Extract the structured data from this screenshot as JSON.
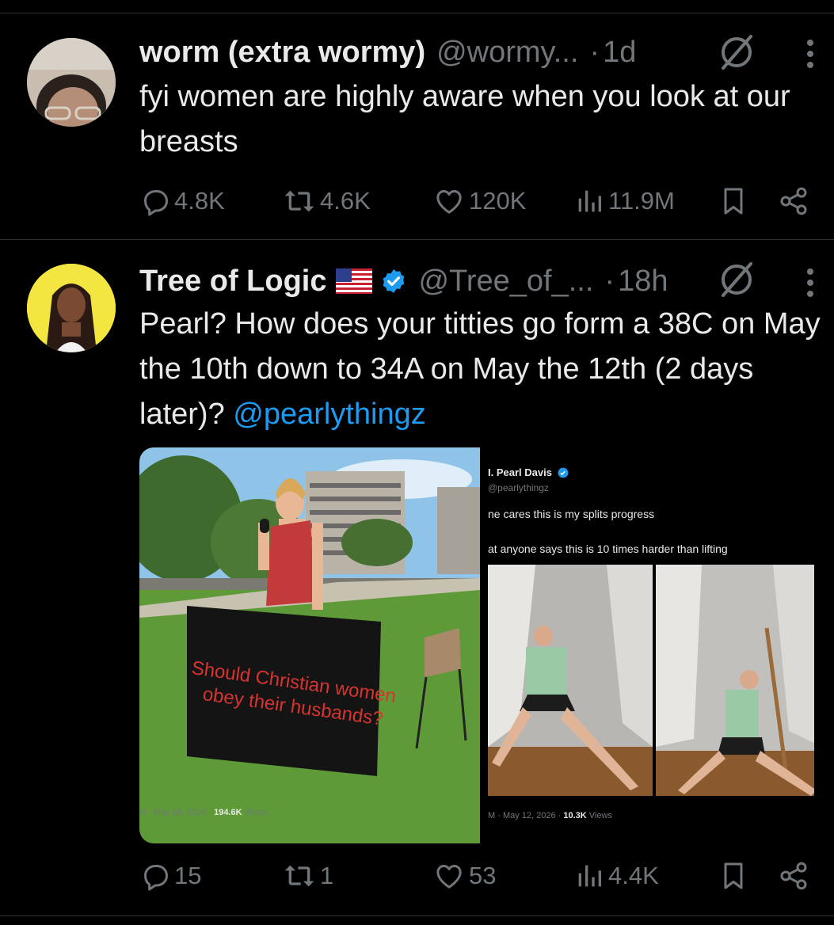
{
  "tweet1": {
    "name": "worm (extra wormy)",
    "handle": "@wormy...",
    "time": "1d",
    "text": "fyi women are highly aware when you look at our breasts",
    "replies": "4.8K",
    "reposts": "4.6K",
    "likes": "120K",
    "views": "11.9M"
  },
  "tweet2": {
    "name": "Tree of Logic",
    "flag": "🇺🇸",
    "handle": "@Tree_of_...",
    "time": "18h",
    "text_main": "Pearl? How does your titties go form a 38C on May the 10th down to 34A on May the 12th (2 days later)? ",
    "mention": "@pearlythingz",
    "replies": "15",
    "reposts": "1",
    "likes": "53",
    "views": "4.4K",
    "media": {
      "left": {
        "sign_line1": "Should Christian women",
        "sign_line2": "obey their husbands?",
        "caption_date": "И · May 10, 2026 · ",
        "caption_views": "194.6K",
        "caption_suffix": " Views"
      },
      "right": {
        "author": "I. Pearl Davis",
        "handle": "@pearlythingz",
        "line1": "ne cares this is my splits progress",
        "line2": "at anyone says this is 10 times harder than lifting",
        "caption_date": "M · May 12, 2026 · ",
        "caption_views": "10.3K",
        "caption_suffix": " Views"
      }
    }
  },
  "colors": {
    "accent": "#1d9bf0",
    "muted": "#71767b",
    "text": "#e7e9ea",
    "bg": "#000000"
  }
}
